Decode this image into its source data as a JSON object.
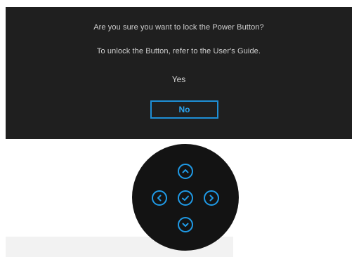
{
  "dialog": {
    "message": "Are you sure you want to lock the Power Button?",
    "hint": "To unlock the Button, refer to the User's Guide.",
    "yes_label": "Yes",
    "no_label": "No",
    "selected_option": "No"
  },
  "joystick": {
    "buttons": [
      {
        "icon": "chevron-up-icon"
      },
      {
        "icon": "chevron-left-icon"
      },
      {
        "icon": "checkmark-icon"
      },
      {
        "icon": "chevron-right-icon"
      },
      {
        "icon": "chevron-down-icon"
      }
    ]
  },
  "colors": {
    "panel_background": "#1f1f1f",
    "accent": "#1e8fd6",
    "text": "#cfcfcf",
    "joystick_body": "#131313"
  }
}
